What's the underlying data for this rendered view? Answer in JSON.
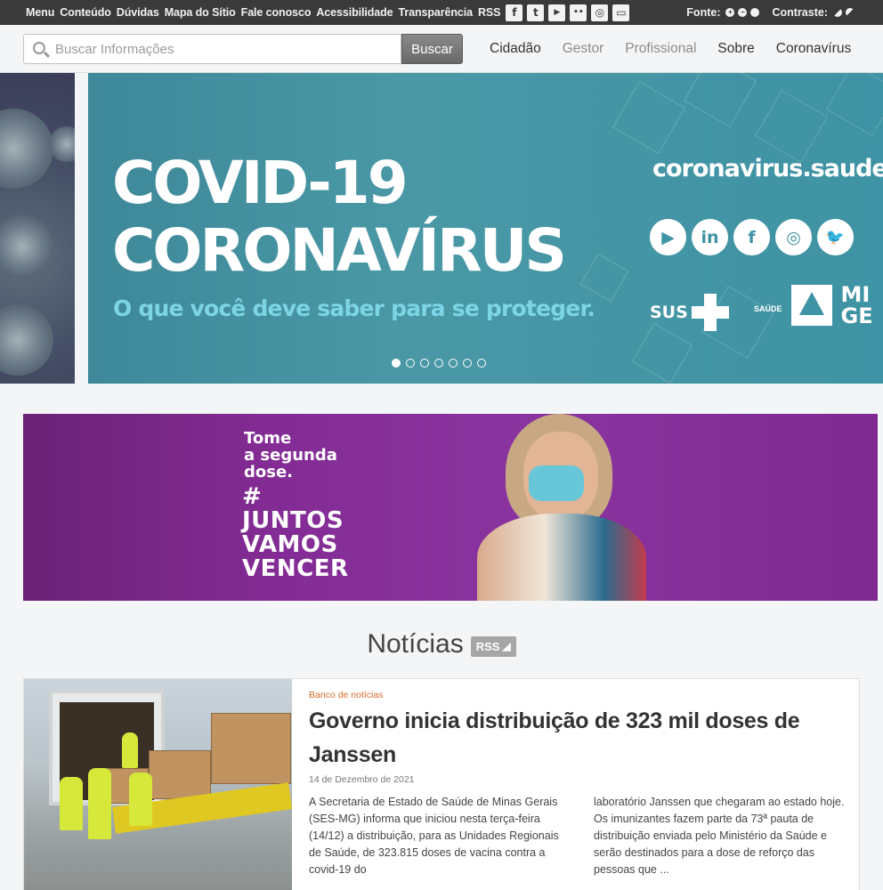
{
  "topbar": {
    "links": [
      "Menu",
      "Conteúdo",
      "Dúvidas",
      "Mapa do Sítio",
      "Fale conosco",
      "Acessibilidade",
      "Transparência",
      "RSS"
    ],
    "social_icons": [
      {
        "name": "facebook-icon",
        "glyph": "f"
      },
      {
        "name": "twitter-icon",
        "glyph": "t"
      },
      {
        "name": "youtube-icon",
        "glyph": "▶"
      },
      {
        "name": "flickr-icon",
        "glyph": "••"
      },
      {
        "name": "instagram-icon",
        "glyph": "◎"
      },
      {
        "name": "chat-icon",
        "glyph": "▭"
      }
    ],
    "fonte_label": "Fonte:",
    "contraste_label": "Contraste:"
  },
  "search": {
    "placeholder": "Buscar Informações",
    "button_label": "Buscar"
  },
  "nav": {
    "items": [
      {
        "label": "Cidadão",
        "active": true
      },
      {
        "label": "Gestor",
        "active": false
      },
      {
        "label": "Profissional",
        "active": false
      },
      {
        "label": "Sobre",
        "active": true
      },
      {
        "label": "Coronavírus",
        "active": true
      }
    ]
  },
  "hero": {
    "title_line1": "COVID-19",
    "title_line2": "CORONAVÍRUS",
    "subtitle": "O que você deve saber para se proteger.",
    "url": "coronavirus.saude.m",
    "social_glyphs": [
      "▶",
      "in",
      "f",
      "◎",
      "🐦"
    ],
    "sus_label": "SUS",
    "saude_label": "SAÚDE",
    "mg_line1": "MI",
    "mg_line2": "GE",
    "slide_count": 7,
    "active_slide": 1
  },
  "promo": {
    "line1": "Tome",
    "line2": "a segunda",
    "line3": "dose.",
    "tag1": "#",
    "tag2": "JUNTOS",
    "tag3": "VAMOS",
    "tag4": "VENCER"
  },
  "news": {
    "heading": "Notícias",
    "rss_label": "RSS",
    "rss_glyph": "◢",
    "item": {
      "category": "Banco de notícias",
      "title": "Governo inicia distribuição de 323 mil doses de Janssen",
      "date": "14 de Dezembro de 2021",
      "body_col1": "A Secretaria de Estado de Saúde de Minas Gerais (SES-MG) informa que iniciou nesta terça-feira (14/12) a distribuição, para as Unidades Regionais de Saúde, de 323.815 doses de vacina contra a covid-19 do",
      "body_col2": "laboratório Janssen que chegaram ao estado hoje. Os imunizantes fazem parte da 73ª pauta de distribuição enviada pelo Ministério da Saúde e serão destinados para a dose de reforço das pessoas que ..."
    }
  }
}
